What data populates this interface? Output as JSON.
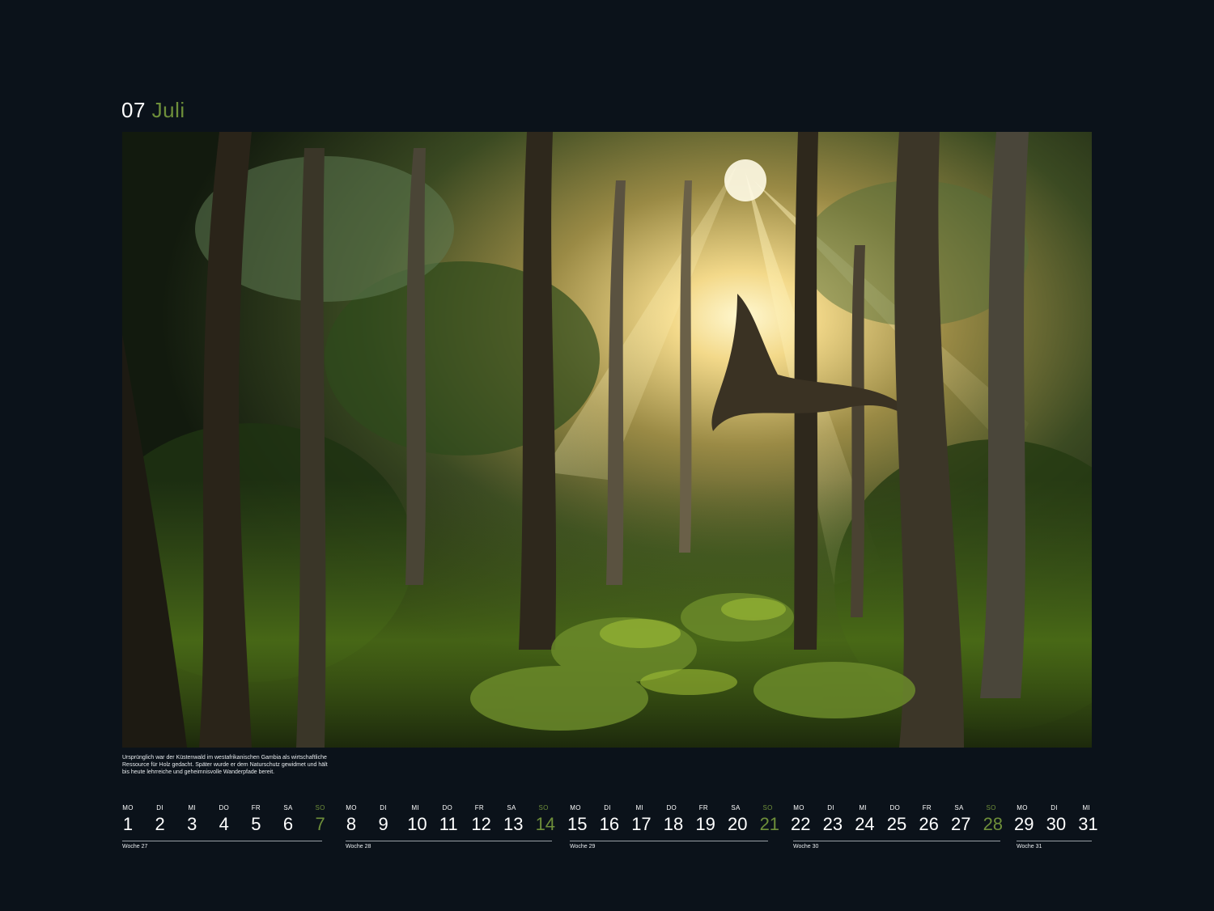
{
  "header": {
    "month_number": "07",
    "month_name": "Juli"
  },
  "caption": "Ursprünglich war der Küstenwald im westafrikanischen Gambia als wirtschaftliche\nRessource für Holz gedacht. Später wurde er dem Naturschutz gewidmet und hält\nbis heute lehrreiche und geheimnisvolle Wanderpfade bereit.",
  "colors": {
    "background": "#0b121a",
    "accent_green": "#6e8f3a",
    "text": "#ffffff"
  },
  "weeks": [
    {
      "label": "Woche 27",
      "days": [
        {
          "name": "MO",
          "date": "1"
        },
        {
          "name": "DI",
          "date": "2"
        },
        {
          "name": "MI",
          "date": "3"
        },
        {
          "name": "DO",
          "date": "4"
        },
        {
          "name": "FR",
          "date": "5"
        },
        {
          "name": "SA",
          "date": "6"
        },
        {
          "name": "SO",
          "date": "7"
        }
      ]
    },
    {
      "label": "Woche 28",
      "days": [
        {
          "name": "MO",
          "date": "8"
        },
        {
          "name": "DI",
          "date": "9"
        },
        {
          "name": "MI",
          "date": "10"
        },
        {
          "name": "DO",
          "date": "11"
        },
        {
          "name": "FR",
          "date": "12"
        },
        {
          "name": "SA",
          "date": "13"
        },
        {
          "name": "SO",
          "date": "14"
        }
      ]
    },
    {
      "label": "Woche 29",
      "days": [
        {
          "name": "MO",
          "date": "15"
        },
        {
          "name": "DI",
          "date": "16"
        },
        {
          "name": "MI",
          "date": "17"
        },
        {
          "name": "DO",
          "date": "18"
        },
        {
          "name": "FR",
          "date": "19"
        },
        {
          "name": "SA",
          "date": "20"
        },
        {
          "name": "SO",
          "date": "21"
        }
      ]
    },
    {
      "label": "Woche 30",
      "days": [
        {
          "name": "MO",
          "date": "22"
        },
        {
          "name": "DI",
          "date": "23"
        },
        {
          "name": "MI",
          "date": "24"
        },
        {
          "name": "DO",
          "date": "25"
        },
        {
          "name": "FR",
          "date": "26"
        },
        {
          "name": "SA",
          "date": "27"
        },
        {
          "name": "SO",
          "date": "28"
        }
      ]
    },
    {
      "label": "Woche 31",
      "days": [
        {
          "name": "MO",
          "date": "29"
        },
        {
          "name": "DI",
          "date": "30"
        },
        {
          "name": "MI",
          "date": "31"
        }
      ]
    }
  ]
}
